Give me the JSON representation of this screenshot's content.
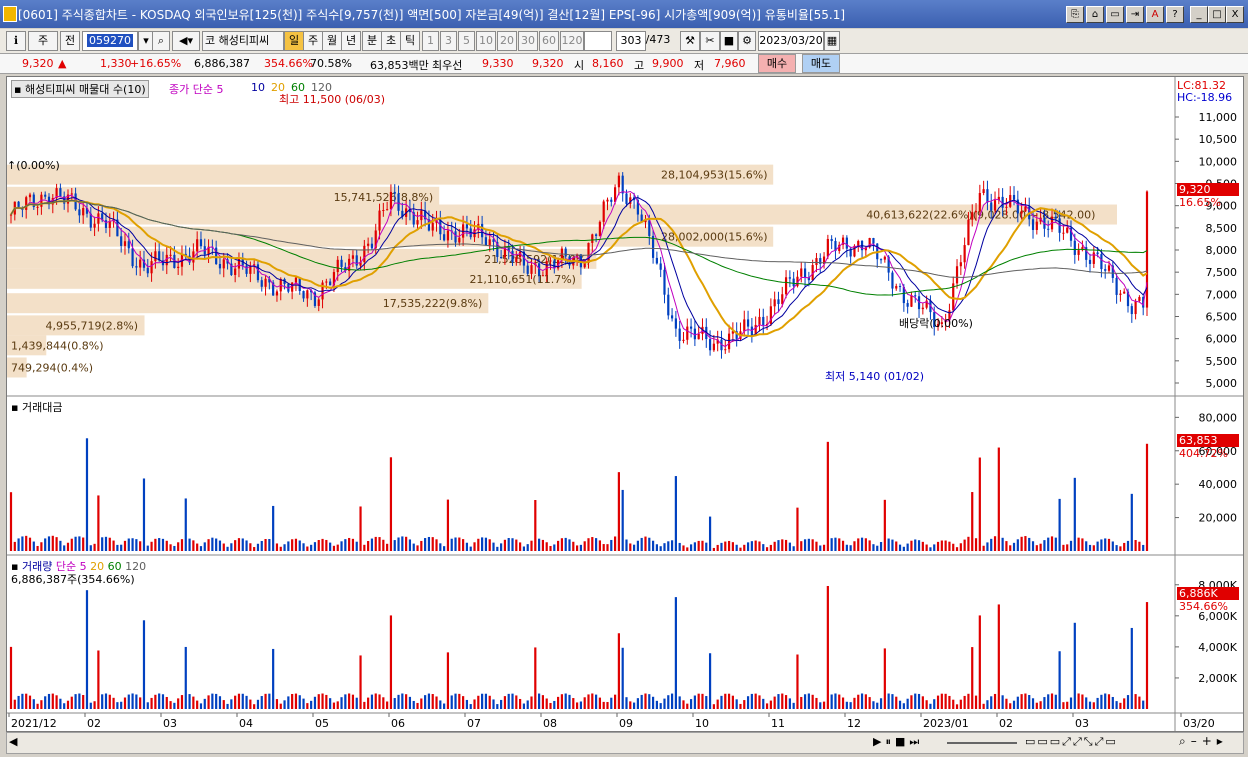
{
  "window": {
    "title": "[0601] 주식종합차트 - KOSDAQ 외국인보유[125(천)] 주식수[9,757(천)] 액면[500] 자본금[49(억)] 결산[12월] EPS[-96] 시가총액[909(억)] 유통비율[55.1]",
    "buttons": [
      "⎘",
      "⌂",
      "▭",
      "⇥",
      "A",
      "?",
      "_",
      "□",
      "X"
    ]
  },
  "toolbar": {
    "market": "주",
    "prev": "전",
    "code": "059270",
    "stock_name": "해성티피씨",
    "periods": [
      "일",
      "주",
      "월",
      "년",
      "분",
      "초",
      "틱"
    ],
    "selected_period": "일",
    "intervals": [
      "1",
      "3",
      "5",
      "10",
      "20",
      "30",
      "60",
      "120"
    ],
    "count": "303",
    "total": "/473",
    "date": "2023/03/20"
  },
  "quote": {
    "price": "9,320",
    "arrow": "▲",
    "change": "1,330",
    "rate": "+16.65%",
    "volume": "6,886,387",
    "vol_ratio": "354.66%",
    "turnover": "70.58%",
    "amount": "63,853백만",
    "best_label": "최우선",
    "ask": "9,330",
    "bid": "9,320",
    "open_label": "시",
    "open": "8,160",
    "high_label": "고",
    "high": "9,900",
    "low_label": "저",
    "low": "7,960",
    "buy": "매수",
    "sell": "매도"
  },
  "panels": {
    "price_legend": [
      "해성티피씨 매물대 수(10)",
      "종가 단순 5",
      "10",
      "20",
      "60",
      "120"
    ],
    "lc": "LC:81.32",
    "hc": "HC:-18.96",
    "last_price": "9,320",
    "last_rate": "16.65%",
    "high_note": "최고 11,500 (06/03)",
    "low_note": "최저 5,140 (01/02)",
    "left_note": "↑(0.00%)",
    "bottom_note": "배당락(0.00%)",
    "amount_title": "거래대금",
    "amount_last": "63,853",
    "amount_rate": "404.72%",
    "volume_legend": [
      "거래량",
      "단순 5",
      "20",
      "60",
      "120"
    ],
    "volume_text": "6,886,387주(354.66%)",
    "volume_last": "6,886K",
    "volume_rate": "354.66%"
  },
  "chart_data": {
    "type": "candlestick",
    "price_axis": [
      "11,000",
      "10,500",
      "10,000",
      "9,500",
      "9,000",
      "8,500",
      "8,000",
      "7,500",
      "7,000",
      "6,500",
      "6,000",
      "5,500",
      "5,000"
    ],
    "amount_axis": [
      "80,000",
      "60,000",
      "40,000",
      "20,000"
    ],
    "volume_axis": [
      "8,000K",
      "6,000K",
      "4,000K",
      "2,000K"
    ],
    "x_axis": [
      "2021/12",
      "02",
      "03",
      "04",
      "05",
      "06",
      "07",
      "08",
      "09",
      "10",
      "11",
      "12",
      "2023/01",
      "02",
      "03",
      "03/20"
    ],
    "volume_profile": [
      {
        "label": "28,104,953(15.6%)",
        "price": 9700,
        "ratio": 0.156
      },
      {
        "label": "40,613,622(22.6%)(9,028.00 ~ 8,542.00)",
        "price": 8800,
        "ratio": 0.226
      },
      {
        "label": "28,002,000(15.6%)",
        "price": 8300,
        "ratio": 0.156
      },
      {
        "label": "15,741,526(8.8%)",
        "price": 9200,
        "ratio": 0.088
      },
      {
        "label": "21,525,592(12.0%)",
        "price": 7800,
        "ratio": 0.12
      },
      {
        "label": "21,110,651(11.7%)",
        "price": 7350,
        "ratio": 0.117
      },
      {
        "label": "17,535,222(9.8%)",
        "price": 6800,
        "ratio": 0.098
      },
      {
        "label": "4,955,719(2.8%)",
        "price": 6300,
        "ratio": 0.028
      },
      {
        "label": "1,439,844(0.8%)",
        "price": 5850,
        "ratio": 0.008
      },
      {
        "label": "749,294(0.4%)",
        "price": 5350,
        "ratio": 0.004
      }
    ]
  },
  "colors": {
    "up": "#e00000",
    "down": "#0040c0",
    "ma5": "#c000c0",
    "ma10": "#0000a0",
    "ma20": "#e0a000",
    "ma60": "#008000",
    "ma120": "#606060",
    "profile": "#f3e0c8"
  }
}
